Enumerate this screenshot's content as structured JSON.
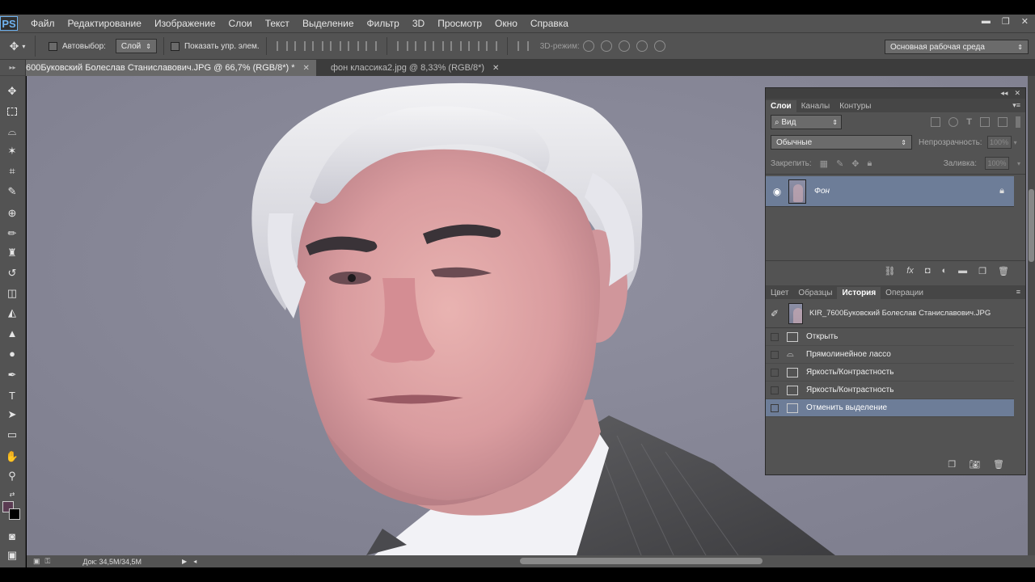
{
  "app": {
    "logo": "PS"
  },
  "menu": [
    "Файл",
    "Редактирование",
    "Изображение",
    "Слои",
    "Текст",
    "Выделение",
    "Фильтр",
    "3D",
    "Просмотр",
    "Окно",
    "Справка"
  ],
  "options": {
    "autoselect_label": "Автовыбор:",
    "autoselect_value": "Слой",
    "show_transform_label": "Показать упр. элем.",
    "mode3d_label": "3D-режим:",
    "workspace": "Основная рабочая среда"
  },
  "tabs": [
    {
      "label": "600Буковский Болеслав Станиславович.JPG @ 66,7% (RGB/8*) *",
      "active": true
    },
    {
      "label": "фон классика2.jpg @ 8,33% (RGB/8*)",
      "active": false
    }
  ],
  "status": {
    "doc_size": "Док: 34,5M/34,5M"
  },
  "layers_panel": {
    "tabs": [
      "Слои",
      "Каналы",
      "Контуры"
    ],
    "kind_filter": "Вид",
    "blend_mode": "Обычные",
    "opacity_label": "Непрозрачность:",
    "opacity_value": "100%",
    "lock_label": "Закрепить:",
    "fill_label": "Заливка:",
    "fill_value": "100%",
    "layers": [
      {
        "name": "Фон",
        "locked": true,
        "visible": true
      }
    ]
  },
  "history_panel": {
    "tabs": [
      "Цвет",
      "Образцы",
      "История",
      "Операции"
    ],
    "snapshot": "KIR_7600Буковский Болеслав Станиславович.JPG",
    "items": [
      "Открыть",
      "Прямолинейное лассо",
      "Яркость/Контрастность",
      "Яркость/Контрастность",
      "Отменить выделение"
    ],
    "active_index": 4
  },
  "colors": {
    "foreground": "#5a3b52",
    "background": "#000000",
    "selection": "#6d7d98"
  }
}
